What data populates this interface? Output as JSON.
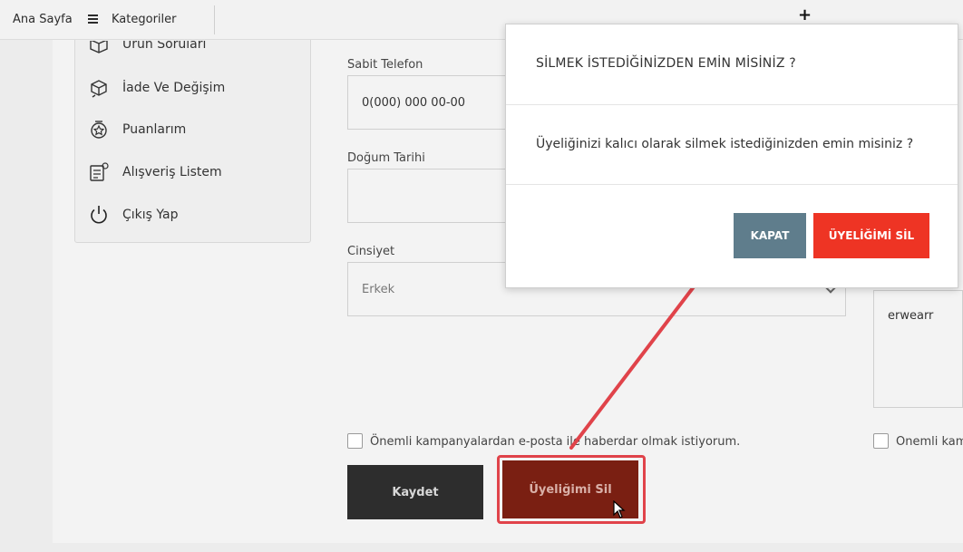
{
  "topbar": {
    "home_label": "Ana Sayfa",
    "categories_label": "Kategoriler"
  },
  "sidebar": {
    "items": [
      {
        "label": "Ürün Soruları",
        "icon": "box-icon"
      },
      {
        "label": "İade Ve Değişim",
        "icon": "return-box-icon"
      },
      {
        "label": "Puanlarım",
        "icon": "points-badge-icon"
      },
      {
        "label": "Alışveriş Listem",
        "icon": "shopping-list-icon"
      },
      {
        "label": "Çıkış Yap",
        "icon": "power-icon"
      }
    ]
  },
  "form": {
    "landline_label": "Sabit Telefon",
    "landline_value": "0(000) 000 00-00",
    "birthdate_label": "Doğum Tarihi",
    "birthdate_value": "",
    "gender_label": "Cinsiyet",
    "gender_value": "Erkek",
    "right_text_value": "erwearr",
    "email_consent_label": "Önemli kampanyalardan e-posta ile haberdar olmak istiyorum.",
    "email_consent_right_label": "Önemli kam",
    "save_label": "Kaydet",
    "delete_label": "Üyeliğimi Sil"
  },
  "modal": {
    "title": "SİLMEK İSTEDİĞİNİZDEN EMİN MİSİNİZ ?",
    "body": "Üyeliğinizi kalıcı olarak silmek istediğinizden emin misiniz ?",
    "close_label": "KAPAT",
    "delete_label": "ÜYELİĞİMİ SİL"
  },
  "colors": {
    "close_button": "#5f7d8c",
    "delete_button": "#ee3424",
    "annotation": "#e0434a"
  }
}
